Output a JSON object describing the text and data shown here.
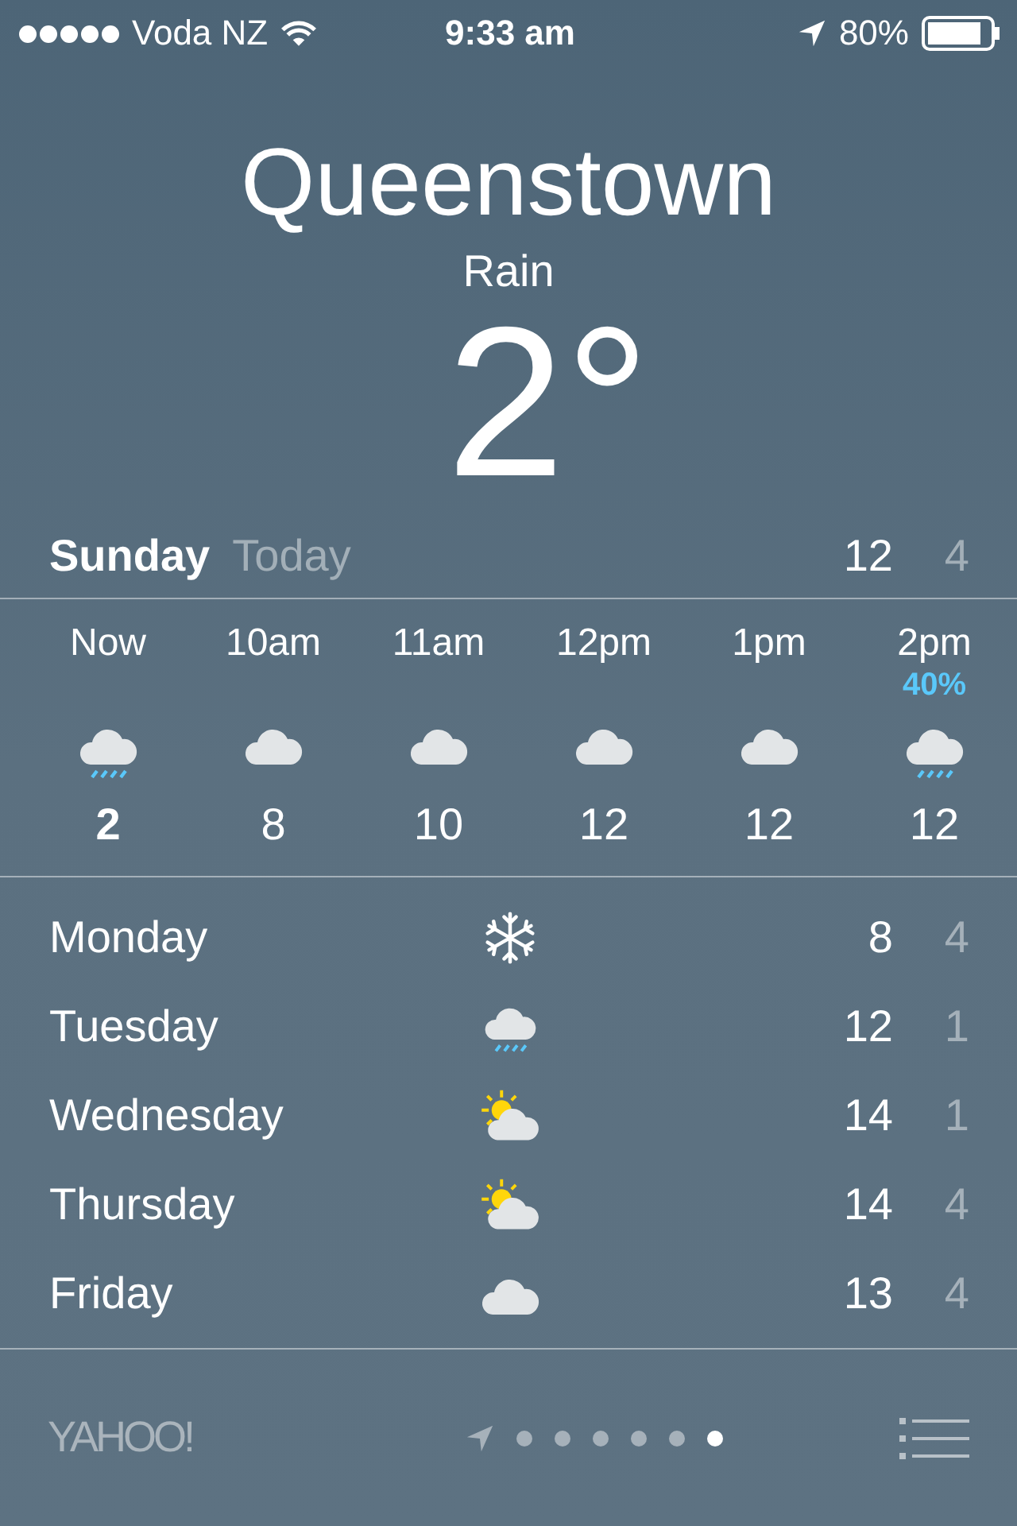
{
  "status_bar": {
    "carrier": "Voda NZ",
    "time": "9:33 am",
    "battery": "80%"
  },
  "city": "Queenstown",
  "condition": "Rain",
  "temperature": "2°",
  "today": {
    "day": "Sunday",
    "label": "Today",
    "high": "12",
    "low": "4"
  },
  "hourly": [
    {
      "time": "Now",
      "kind": "rain",
      "temp": "2",
      "bold": true
    },
    {
      "time": "10am",
      "kind": "cloud",
      "temp": "8",
      "bold": false
    },
    {
      "time": "11am",
      "kind": "cloud",
      "temp": "10",
      "bold": false
    },
    {
      "time": "12pm",
      "kind": "cloud",
      "temp": "12",
      "bold": false
    },
    {
      "time": "1pm",
      "kind": "cloud",
      "temp": "12",
      "bold": false
    },
    {
      "time": "2pm",
      "chance": "40%",
      "kind": "rain",
      "temp": "12",
      "bold": false
    }
  ],
  "daily": [
    {
      "day": "Monday",
      "kind": "snow",
      "high": "8",
      "low": "4"
    },
    {
      "day": "Tuesday",
      "kind": "rain",
      "high": "12",
      "low": "1"
    },
    {
      "day": "Wednesday",
      "kind": "partly_sunny",
      "high": "14",
      "low": "1"
    },
    {
      "day": "Thursday",
      "kind": "partly_sunny",
      "high": "14",
      "low": "4"
    },
    {
      "day": "Friday",
      "kind": "cloud",
      "high": "13",
      "low": "4"
    }
  ],
  "footer": {
    "logo": "YAHOO!",
    "pages": [
      {
        "selected": false
      },
      {
        "selected": false
      },
      {
        "selected": false
      },
      {
        "selected": false
      },
      {
        "selected": false
      },
      {
        "selected": true
      }
    ]
  }
}
